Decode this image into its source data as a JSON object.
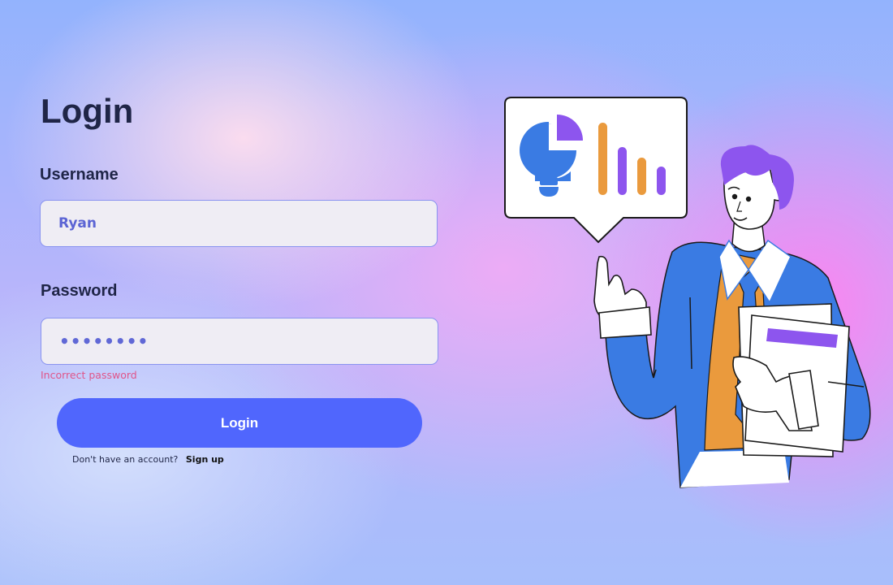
{
  "page": {
    "title": "Login"
  },
  "username": {
    "label": "Username",
    "value": "Ryan"
  },
  "password": {
    "label": "Password",
    "masked_value": "••••••••",
    "error": "Incorrect password"
  },
  "login_button": {
    "label": "Login"
  },
  "signup": {
    "prompt": "Don't have an account?",
    "link_label": "Sign up"
  },
  "illustration": {
    "icon": "businessman-presenting-chart-illustration",
    "chart_icons": [
      "lightbulb-pie-chart-icon",
      "bar-chart-icon"
    ]
  },
  "colors": {
    "accent": "#5066fd",
    "title": "#1f2547",
    "input_text": "#5b64d4",
    "error": "#e0558a",
    "input_border": "#8a94ef"
  }
}
